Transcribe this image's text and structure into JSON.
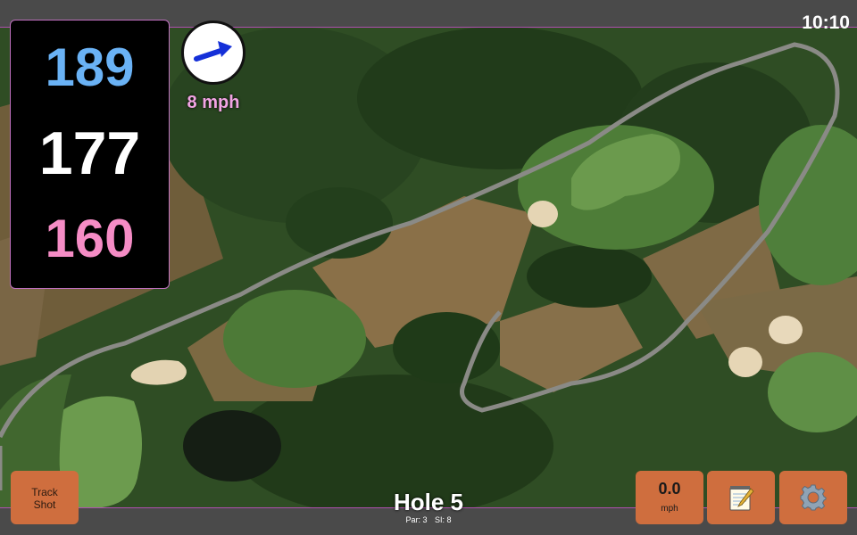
{
  "status": {
    "time": "10:10"
  },
  "yardages": {
    "back": "189",
    "center": "177",
    "front": "160"
  },
  "wind": {
    "speed": "8 mph",
    "direction_icon": "wind-arrow-icon"
  },
  "hole": {
    "title": "Hole 5",
    "par": "Par: 3",
    "stroke_index": "SI: 8"
  },
  "buttons": {
    "track_shot_line1": "Track",
    "track_shot_line2": "Shot",
    "speed_value": "0.0",
    "speed_unit": "mph",
    "notes_icon": "notepad-icon",
    "settings_icon": "gear-icon"
  },
  "colors": {
    "back": "#6ab2f5",
    "center": "#ffffff",
    "front": "#f58cc5",
    "button": "#cf6e3e",
    "wind_text": "#f2a4e4"
  }
}
